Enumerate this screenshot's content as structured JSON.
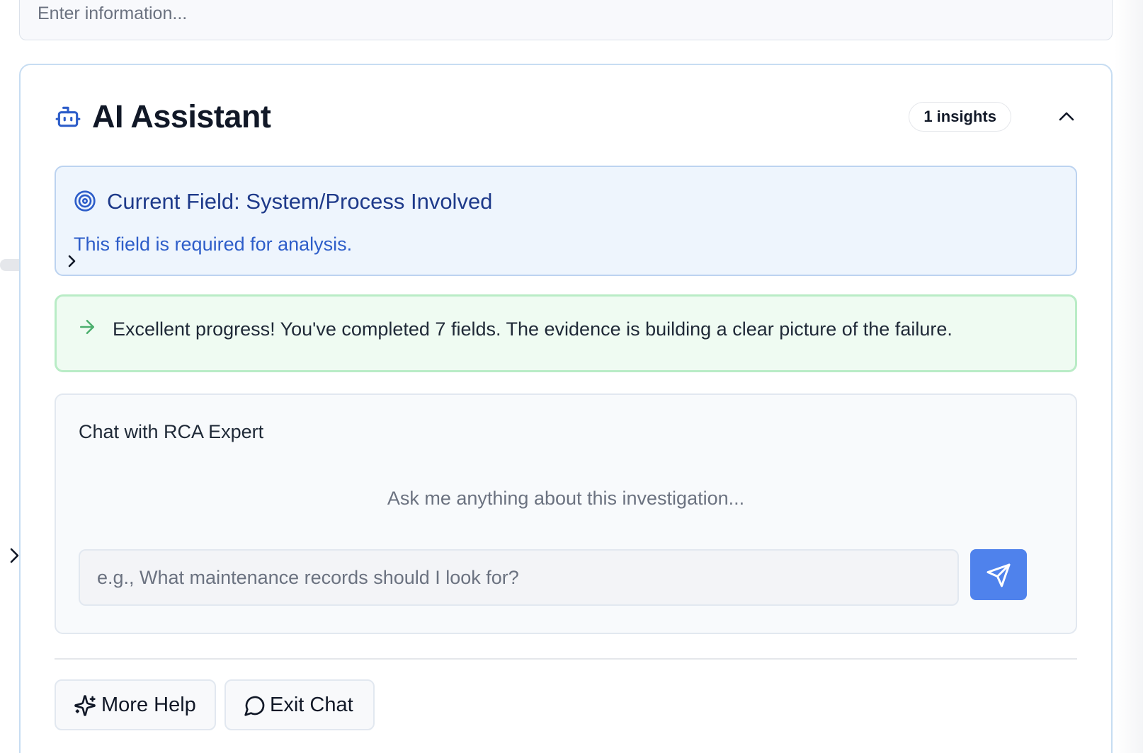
{
  "top_field": {
    "placeholder": "Enter information..."
  },
  "assistant": {
    "title": "AI Assistant",
    "insights_badge": "1 insights",
    "icon": "bot-icon",
    "collapse_icon": "chevron-up-icon",
    "accent_color": "#2d5dc9"
  },
  "current_field": {
    "title": "Current Field: System/Process Involved",
    "message": "This field is required for analysis.",
    "icon": "target-icon"
  },
  "progress": {
    "message": "Excellent progress! You've completed 7 fields. The evidence is building a clear picture of the failure.",
    "icon": "arrow-right-icon",
    "color": "#4caf6e"
  },
  "chat": {
    "title": "Chat with RCA Expert",
    "empty_state": "Ask me anything about this investigation...",
    "input_placeholder": "e.g., What maintenance records should I look for?",
    "send_icon": "send-icon",
    "send_color": "#4f82ec"
  },
  "actions": {
    "more_help_label": "More Help",
    "more_help_icon": "sparkles-icon",
    "exit_chat_label": "Exit Chat",
    "exit_chat_icon": "message-circle-icon"
  }
}
